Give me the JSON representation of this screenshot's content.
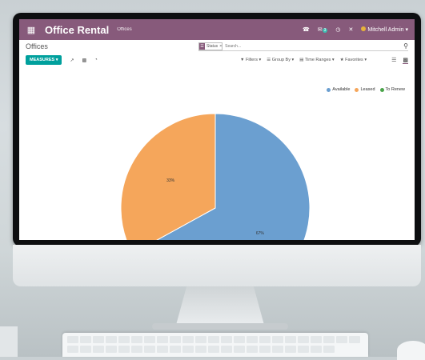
{
  "navbar": {
    "app_title": "Office Rental",
    "menu_item": "Offices",
    "badge_count": "3",
    "user_name": "Mitchell Admin"
  },
  "breadcrumb": "Offices",
  "search": {
    "facet_label": "Status",
    "placeholder": "Search..."
  },
  "controls": {
    "measures_label": "MEASURES",
    "filters_label": "Filters",
    "group_by_label": "Group By",
    "time_ranges_label": "Time Ranges",
    "favorites_label": "Favorites"
  },
  "chart_data": {
    "type": "pie",
    "categories": [
      "Available",
      "Leased",
      "To Renew"
    ],
    "values": [
      67,
      33,
      0
    ],
    "data_labels": [
      "67%",
      "33%"
    ],
    "colors": [
      "#6b9fd0",
      "#f5a65b",
      "#4aa44a"
    ],
    "legend_position": "top-right"
  }
}
